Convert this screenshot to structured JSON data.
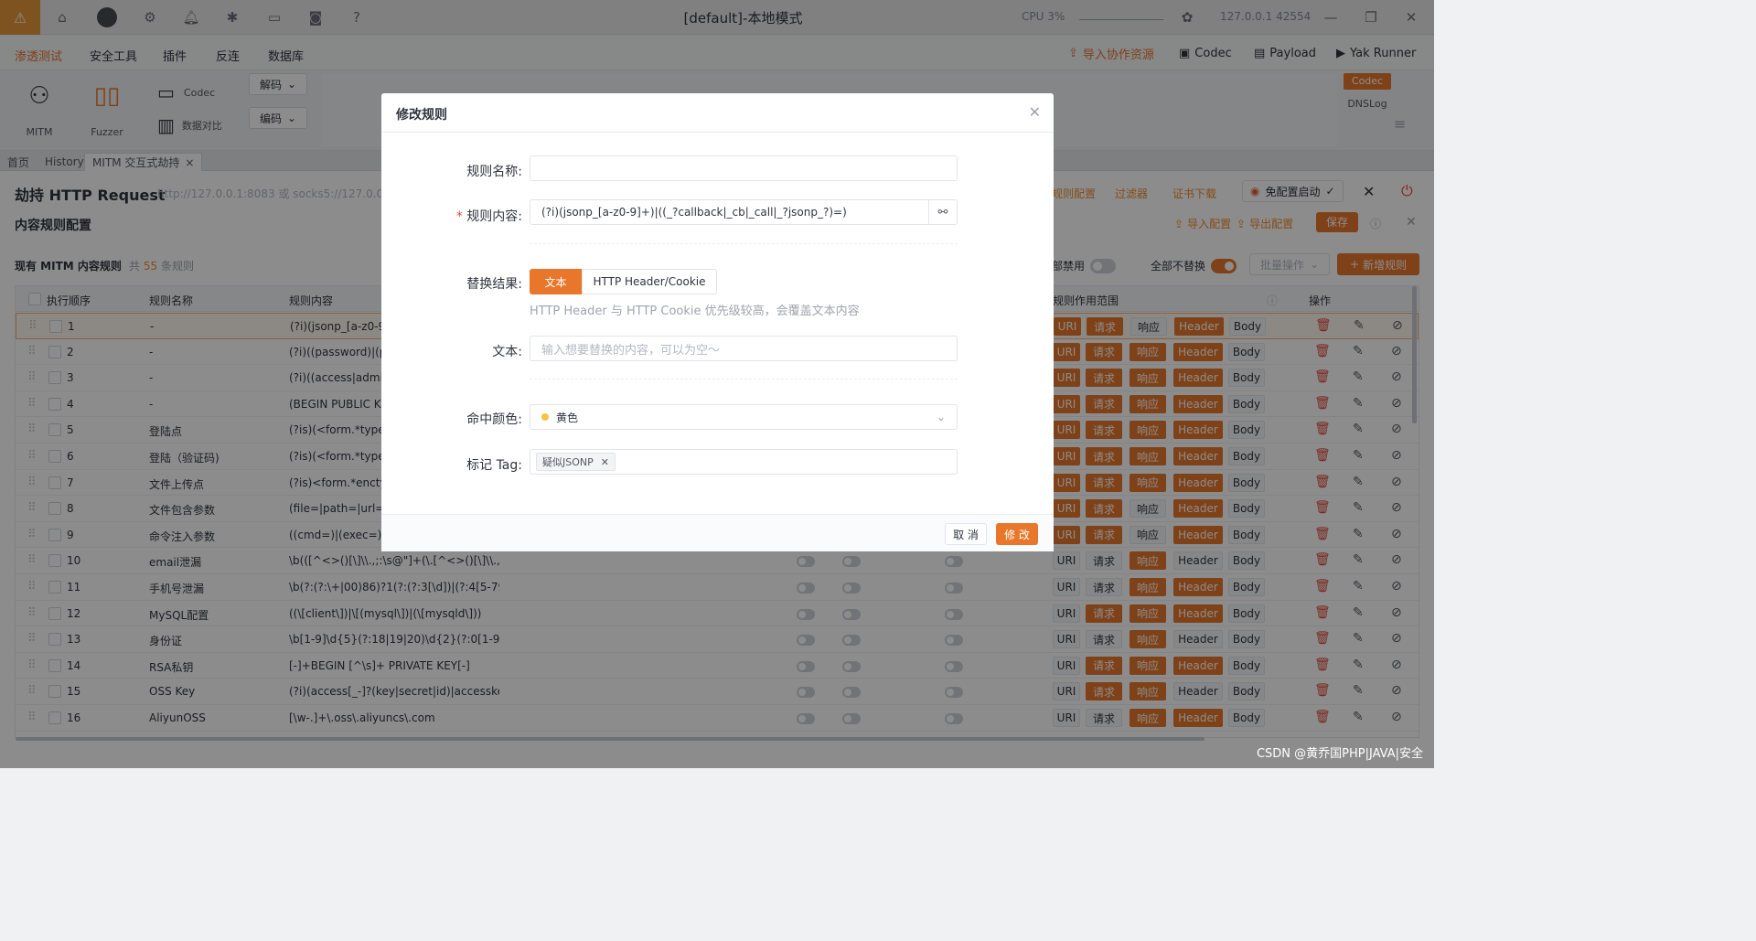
{
  "window": {
    "title": "[default]-本地模式",
    "cpu": "CPU 3%",
    "engine": "127.0.0.1  42554"
  },
  "nav": {
    "items": [
      "渗透测试",
      "安全工具",
      "插件",
      "反连",
      "数据库"
    ],
    "right_buttons": [
      "导入协作资源",
      "Codec",
      "Payload",
      "Yak Runner"
    ]
  },
  "tools": {
    "mitm": "MITM",
    "fuzzer": "Fuzzer",
    "codec": "Codec",
    "compare": "数据对比",
    "decode": "解码",
    "encode": "编码",
    "codec_tag": "Codec",
    "dnslog": "DNSLog"
  },
  "tabs": [
    "首页",
    "History",
    "MITM 交互式劫持"
  ],
  "panel": {
    "hijack_title": "劫持 HTTP Request",
    "proxy_addr": "http://127.0.0.1:8083 或 socks5://127.0.0.1:80",
    "header_links": [
      "规则配置",
      "过滤器",
      "证书下载"
    ],
    "chrome_btn": "免配置启动",
    "content_title": "内容规则配置",
    "import_btn": "导入配置",
    "export_btn": "导出配置",
    "save_btn": "保存",
    "rules_label": "现有 MITM 内容规则",
    "rules_count_prefix": "共",
    "rules_count": "55",
    "rules_count_suffix": "条规则",
    "all_disable": "全部禁用",
    "all_disable_visible": "部禁用",
    "all_no_replace": "全部不替换",
    "batch": "批量操作",
    "add_rule": "新增规则"
  },
  "table": {
    "headers": [
      "执行顺序",
      "规则名称",
      "规则内容",
      "规则作用范围",
      "操作"
    ],
    "rows": [
      {
        "idx": "1",
        "name": "-",
        "content": "(?i)(jsonp_[a-z0-9]+",
        "chips": [
          1,
          1,
          0,
          1,
          0
        ]
      },
      {
        "idx": "2",
        "name": "-",
        "content": "(?i)((password)|(pas",
        "chips": [
          1,
          1,
          1,
          1,
          0
        ]
      },
      {
        "idx": "3",
        "name": "-",
        "content": "(?i)((access|admin|a",
        "chips": [
          1,
          1,
          1,
          1,
          0
        ]
      },
      {
        "idx": "4",
        "name": "-",
        "content": "(BEGIN PUBLIC KEY",
        "chips": [
          1,
          1,
          1,
          1,
          0
        ]
      },
      {
        "idx": "5",
        "name": "登陆点",
        "content": "(?is)(<form.*type=.",
        "chips": [
          1,
          1,
          1,
          1,
          0
        ]
      },
      {
        "idx": "6",
        "name": "登陆（验证码)",
        "content": "(?is)(<form.*type=.",
        "chips": [
          1,
          1,
          1,
          1,
          0
        ]
      },
      {
        "idx": "7",
        "name": "文件上传点",
        "content": "(?is)<form.*enctype",
        "chips": [
          1,
          1,
          1,
          1,
          0
        ]
      },
      {
        "idx": "8",
        "name": "文件包含参数",
        "content": "(file=|path=|url=|la",
        "chips": [
          1,
          1,
          0,
          1,
          0
        ]
      },
      {
        "idx": "9",
        "name": "命令注入参数",
        "content": "((cmd=)|(exec=)|(co",
        "chips": [
          1,
          1,
          0,
          1,
          0
        ]
      },
      {
        "idx": "10",
        "name": "email泄漏",
        "content": "\\b(([^<>()[\\]\\\\.,;:\\s@\"]+(\\.[^<>()[\\]\\\\.,;:\\...",
        "chips": [
          0,
          0,
          1,
          0,
          0
        ]
      },
      {
        "idx": "11",
        "name": "手机号泄漏",
        "content": "\\b(?:(?:\\+|00)86)?1(?:(?:3[\\d])|(?:4[5-79])...",
        "chips": [
          0,
          0,
          1,
          1,
          0
        ]
      },
      {
        "idx": "12",
        "name": "MySQL配置",
        "content": "((\\[client\\])|\\[(mysql\\])|(\\[mysqld\\]))",
        "chips": [
          0,
          1,
          1,
          1,
          0
        ]
      },
      {
        "idx": "13",
        "name": "身份证",
        "content": "\\b[1-9]\\d{5}(?:18|19|20)\\d{2}(?:0[1-9]|10...",
        "chips": [
          0,
          0,
          1,
          0,
          0
        ]
      },
      {
        "idx": "14",
        "name": "RSA私钥",
        "content": "[-]+BEGIN [^\\s]+ PRIVATE KEY[-]",
        "chips": [
          0,
          1,
          1,
          1,
          0
        ]
      },
      {
        "idx": "15",
        "name": "OSS Key",
        "content": "(?i)(access[_-]?(key|secret|id)|accesskey(...",
        "chips": [
          0,
          1,
          1,
          0,
          0
        ]
      },
      {
        "idx": "16",
        "name": "AliyunOSS",
        "content": "[\\w-.]+\\.oss\\.aliyuncs\\.com",
        "chips": [
          0,
          0,
          1,
          1,
          0
        ]
      }
    ],
    "scope_chips": [
      "URI",
      "请求",
      "响应",
      "Header",
      "Body"
    ]
  },
  "modal": {
    "title": "修改规则",
    "name_label": "规则名称:",
    "name_value": "",
    "content_label": "规则内容:",
    "content_value": "(?i)(jsonp_[a-z0-9]+)|((_?callback|_cb|_call|_?jsonp_?)=)",
    "result_label": "替换结果:",
    "result_tab_text": "文本",
    "result_tab_header": "HTTP Header/Cookie",
    "result_hint": "HTTP Header 与 HTTP Cookie 优先级较高，会覆盖文本内容",
    "text_label": "文本:",
    "text_placeholder": "输入想要替换的内容，可以为空～",
    "color_label": "命中颜色:",
    "color_value": "黄色",
    "tag_label": "标记 Tag:",
    "tag_value": "疑似JSONP",
    "cancel": "取 消",
    "submit": "修 改"
  },
  "watermark": "CSDN @黄乔国PHP|JAVA|安全",
  "colors": {
    "accent": "#e8772b",
    "warning": "#e8973a",
    "yellow_dot": "#f6c344"
  }
}
